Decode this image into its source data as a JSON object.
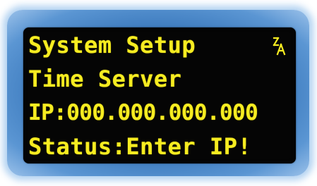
{
  "display": {
    "lines": [
      "System Setup",
      "Time Server",
      "IP:000.000.000.000",
      "Status:Enter IP!"
    ],
    "mode_icon": "input-mode-icon",
    "text_color": "#f6ec21",
    "screen_color": "#050505",
    "bezel_color": "#3e7cbf"
  }
}
